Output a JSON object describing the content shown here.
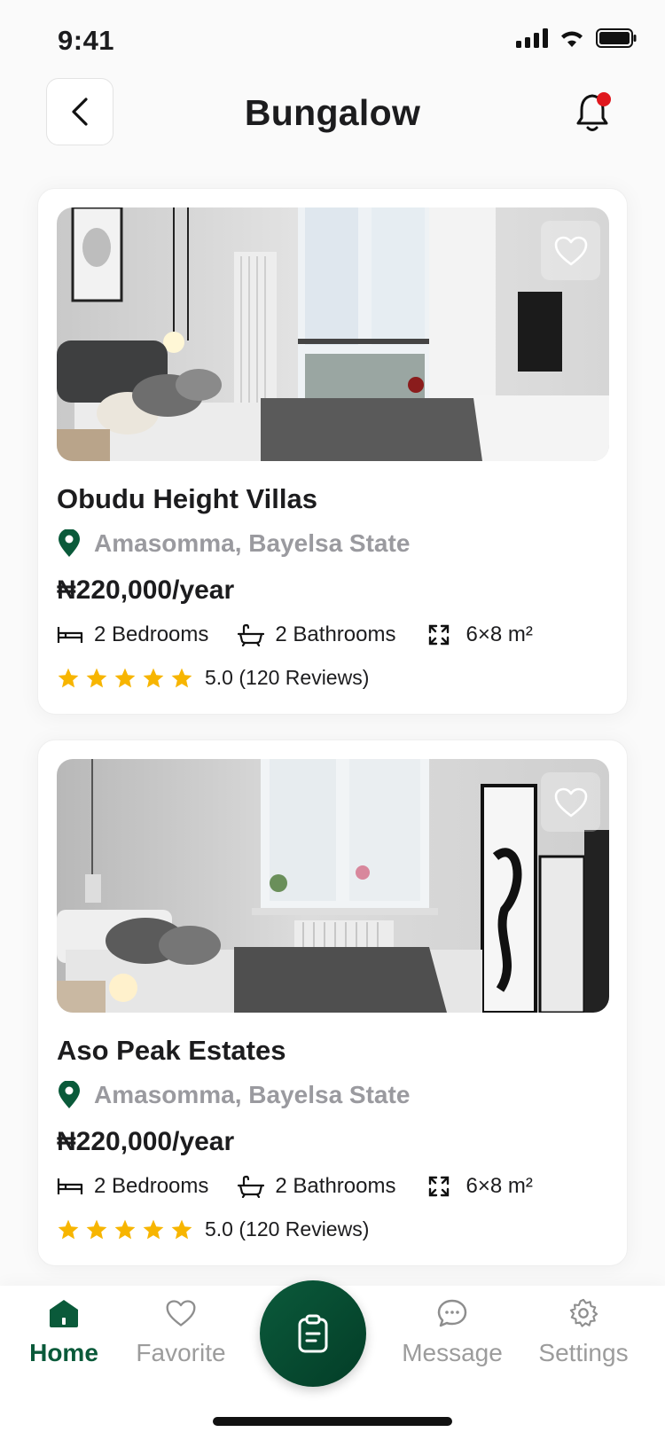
{
  "status_bar": {
    "time": "9:41"
  },
  "header": {
    "title": "Bungalow"
  },
  "listings": [
    {
      "name": "Obudu Height Villas",
      "location": "Amasomma, Bayelsa State",
      "price": "₦220,000/year",
      "bedrooms": "2 Bedrooms",
      "bathrooms": "2 Bathrooms",
      "size": "6×8 m²",
      "stars": 5,
      "rating_text": "5.0 (120 Reviews)"
    },
    {
      "name": "Aso Peak Estates",
      "location": "Amasomma, Bayelsa State",
      "price": "₦220,000/year",
      "bedrooms": "2 Bedrooms",
      "bathrooms": "2 Bathrooms",
      "size": "6×8 m²",
      "stars": 5,
      "rating_text": "5.0 (120 Reviews)"
    }
  ],
  "tabbar": {
    "home": "Home",
    "favorite": "Favorite",
    "message": "Message",
    "settings": "Settings"
  },
  "colors": {
    "brand_green": "#0a5a3a",
    "star": "#f7b500",
    "notification_dot": "#e0181e"
  }
}
